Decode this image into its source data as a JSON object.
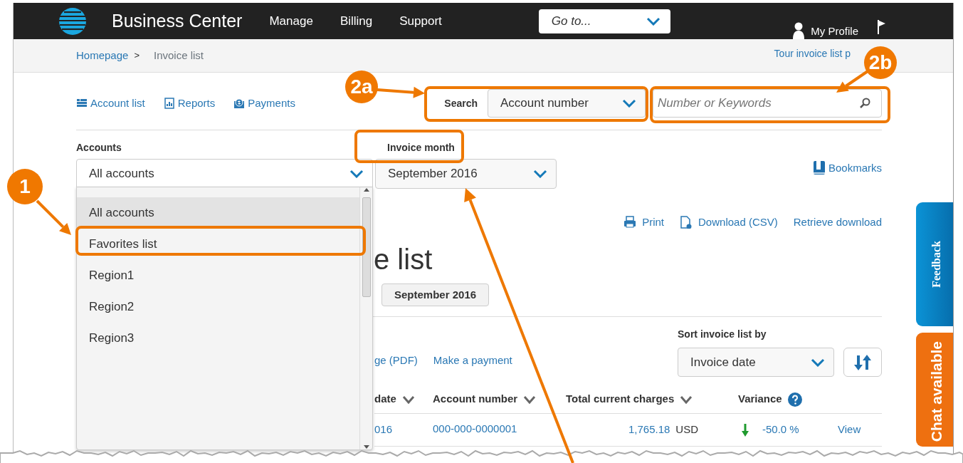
{
  "header": {
    "brand": "Business Center",
    "nav": [
      {
        "label": "Manage"
      },
      {
        "label": "Billing"
      },
      {
        "label": "Support"
      }
    ],
    "goto": "Go to...",
    "profile": "My Profile"
  },
  "breadcrumb": {
    "items": [
      {
        "label": "Homepage",
        "link": true
      },
      {
        "label": "Invoice list",
        "link": false
      }
    ],
    "separator": ">",
    "tour_link": "Tour invoice list p"
  },
  "quick_links": [
    {
      "label": "Account list"
    },
    {
      "label": "Reports"
    },
    {
      "label": "Payments"
    }
  ],
  "search": {
    "label": "Search",
    "field": "Account number",
    "placeholder": "Number or Keywords"
  },
  "filters": {
    "accounts_label": "Accounts",
    "accounts_value": "All accounts",
    "month_label": "Invoice month",
    "month_value": "September 2016",
    "bookmarks": "Bookmarks"
  },
  "accounts_menu": [
    {
      "label": "All accounts",
      "selected": true
    },
    {
      "label": "Favorites list",
      "selected": false
    },
    {
      "label": "Region1",
      "selected": false
    },
    {
      "label": "Region2",
      "selected": false
    },
    {
      "label": "Region3",
      "selected": false
    }
  ],
  "actions": [
    {
      "label": "Print"
    },
    {
      "label": "Download (CSV)"
    },
    {
      "label": "Retrieve download"
    }
  ],
  "heading": "e list",
  "month_chip": "September 2016",
  "row_links": [
    "ge (PDF)",
    "Make a payment"
  ],
  "sort": {
    "label": "Sort invoice list by",
    "value": "Invoice date"
  },
  "table": {
    "columns": [
      {
        "label": "date",
        "sortable": true,
        "help": false
      },
      {
        "label": "Account number",
        "sortable": true,
        "help": false
      },
      {
        "label": "Total current charges",
        "sortable": true,
        "help": false
      },
      {
        "label": "Variance",
        "sortable": false,
        "help": true
      }
    ],
    "rows": [
      {
        "date": "016",
        "account": "000-000-0000001",
        "amount": "1,765.18",
        "currency": "USD",
        "decrease": true,
        "variance": "-50.0 %",
        "action": "View"
      }
    ]
  },
  "side_tabs": [
    {
      "label": "Feedback",
      "kind": "feedback"
    },
    {
      "label": "Chat available",
      "kind": "chat"
    }
  ],
  "callouts": [
    {
      "label": "1"
    },
    {
      "label": "2a"
    },
    {
      "label": "2b"
    }
  ]
}
